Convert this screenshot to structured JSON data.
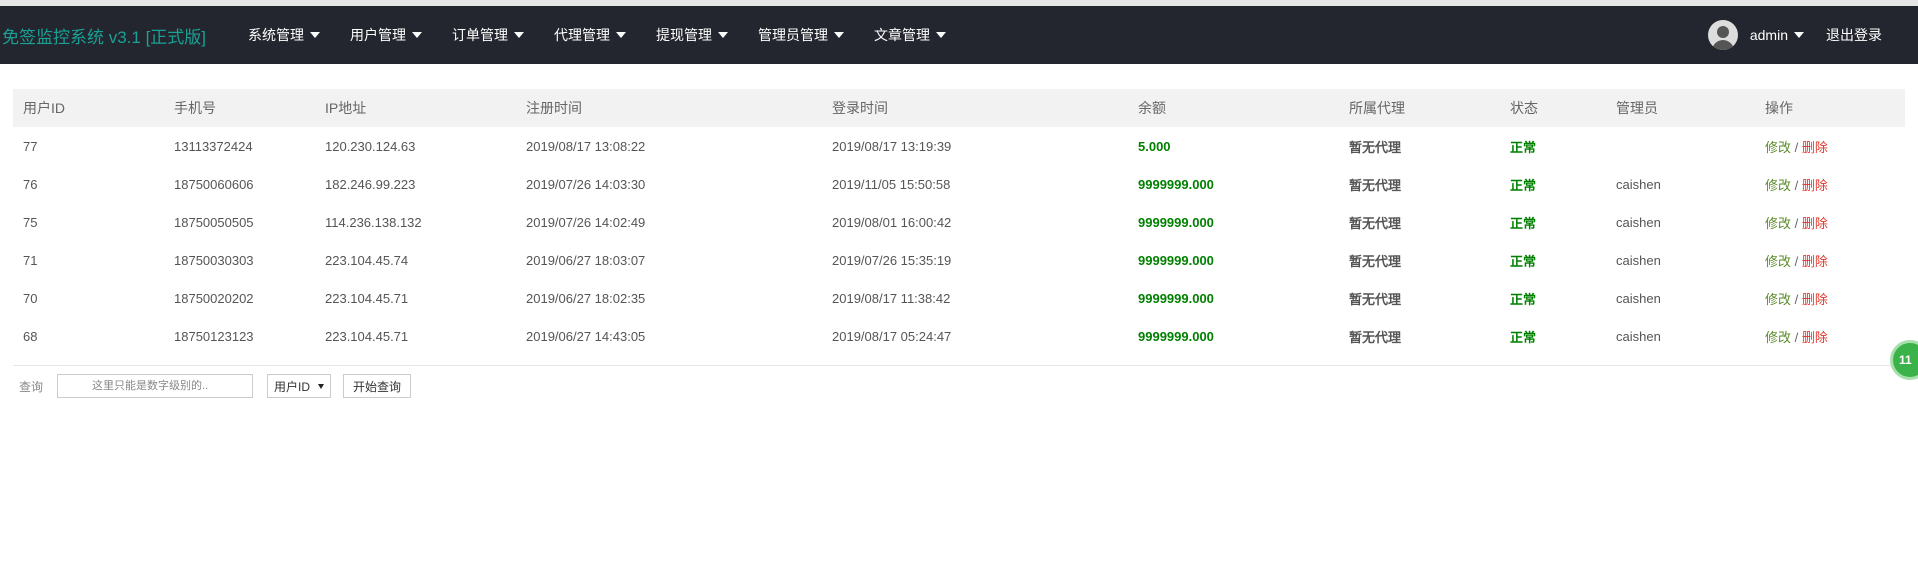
{
  "header": {
    "brand": "免签监控系统 v3.1 [正式版]",
    "nav": [
      "系统管理",
      "用户管理",
      "订单管理",
      "代理管理",
      "提现管理",
      "管理员管理",
      "文章管理"
    ],
    "user": "admin",
    "logout": "退出登录"
  },
  "table": {
    "columns": [
      "用户ID",
      "手机号",
      "IP地址",
      "注册时间",
      "登录时间",
      "余额",
      "所属代理",
      "状态",
      "管理员",
      "操作"
    ],
    "rows": [
      {
        "id": "77",
        "phone": "13113372424",
        "ip": "120.230.124.63",
        "reg": "2019/08/17 13:08:22",
        "login": "2019/08/17 13:19:39",
        "balance": "5.000",
        "agent": "暂无代理",
        "status": "正常",
        "admin": ""
      },
      {
        "id": "76",
        "phone": "18750060606",
        "ip": "182.246.99.223",
        "reg": "2019/07/26 14:03:30",
        "login": "2019/11/05 15:50:58",
        "balance": "9999999.000",
        "agent": "暂无代理",
        "status": "正常",
        "admin": "caishen"
      },
      {
        "id": "75",
        "phone": "18750050505",
        "ip": "114.236.138.132",
        "reg": "2019/07/26 14:02:49",
        "login": "2019/08/01 16:00:42",
        "balance": "9999999.000",
        "agent": "暂无代理",
        "status": "正常",
        "admin": "caishen"
      },
      {
        "id": "71",
        "phone": "18750030303",
        "ip": "223.104.45.74",
        "reg": "2019/06/27 18:03:07",
        "login": "2019/07/26 15:35:19",
        "balance": "9999999.000",
        "agent": "暂无代理",
        "status": "正常",
        "admin": "caishen"
      },
      {
        "id": "70",
        "phone": "18750020202",
        "ip": "223.104.45.71",
        "reg": "2019/06/27 18:02:35",
        "login": "2019/08/17 11:38:42",
        "balance": "9999999.000",
        "agent": "暂无代理",
        "status": "正常",
        "admin": "caishen"
      },
      {
        "id": "68",
        "phone": "18750123123",
        "ip": "223.104.45.71",
        "reg": "2019/06/27 14:43:05",
        "login": "2019/08/17 05:24:47",
        "balance": "9999999.000",
        "agent": "暂无代理",
        "status": "正常",
        "admin": "caishen"
      }
    ],
    "edit_label": "修改",
    "separator": "/",
    "delete_label": "删除"
  },
  "query": {
    "label": "查询",
    "placeholder": "这里只能是数字级别的..",
    "select_value": "用户ID",
    "button": "开始查询"
  },
  "float_ball": {
    "label": "11"
  },
  "colors": {
    "navbar_bg": "#23262e",
    "brand": "#1aa094",
    "balance": "#008000",
    "status_ok": "#008000",
    "edit": "#5b8c2a",
    "delete": "#e0352b"
  },
  "icons": {
    "avatar": "user-avatar-icon",
    "dropdown": "caret-down-icon"
  }
}
